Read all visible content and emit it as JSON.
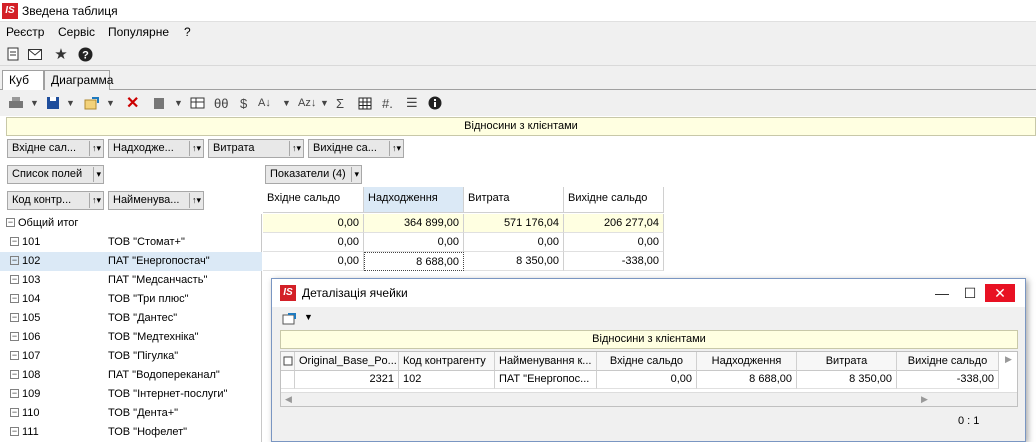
{
  "window": {
    "title": "Зведена таблиця",
    "logo": "IS"
  },
  "menu": [
    "Реєстр",
    "Сервіс",
    "Популярне",
    "?"
  ],
  "tabs": [
    "Куб",
    "Диаграмма"
  ],
  "banner": "Відносини з клієнтами",
  "data_fields": [
    "Вхідне сал...",
    "Надходже...",
    "Витрата",
    "Вихідне са..."
  ],
  "field_list_label": "Список полей",
  "indicators_label": "Показатели (4)",
  "row_fields": [
    "Код контр...",
    "Найменува..."
  ],
  "columns": [
    "Вхідне сальдо",
    "Надходження",
    "Витрата",
    "Вихідне сальдо"
  ],
  "tree": {
    "total_label": "Общий итог",
    "rows": [
      {
        "code": "101",
        "name": "ТОВ \"Стомат+\""
      },
      {
        "code": "102",
        "name": "ПАТ \"Енергопостач\""
      },
      {
        "code": "103",
        "name": "ПАТ \"Медсанчасть\""
      },
      {
        "code": "104",
        "name": "ТОВ \"Три плюс\""
      },
      {
        "code": "105",
        "name": "ТОВ \"Дантес\""
      },
      {
        "code": "106",
        "name": "ТОВ \"Медтехніка\""
      },
      {
        "code": "107",
        "name": "ТОВ \"Пігулка\""
      },
      {
        "code": "108",
        "name": "ПАТ \"Водопереканал\""
      },
      {
        "code": "109",
        "name": "ТОВ \"Інтернет-послуги\""
      },
      {
        "code": "110",
        "name": "ТОВ \"Дента+\""
      },
      {
        "code": "111",
        "name": "ТОВ \"Нофелет\""
      }
    ]
  },
  "values": [
    [
      "0,00",
      "364 899,00",
      "571 176,04",
      "206 277,04"
    ],
    [
      "0,00",
      "0,00",
      "0,00",
      "0,00"
    ],
    [
      "0,00",
      "8 688,00",
      "8 350,00",
      "-338,00"
    ]
  ],
  "dialog": {
    "title": "Деталізація ячейки",
    "logo": "IS",
    "banner": "Відносини з клієнтами",
    "headers": [
      "Original_Base_Po...",
      "Код контрагенту",
      "Найменування к...",
      "Вхідне сальдо",
      "Надходження",
      "Витрата",
      "Вихідне сальдо"
    ],
    "row": [
      "2321",
      "102",
      "ПАТ \"Енергопос...",
      "0,00",
      "8 688,00",
      "8 350,00",
      "-338,00"
    ],
    "status": "0 : 1"
  }
}
